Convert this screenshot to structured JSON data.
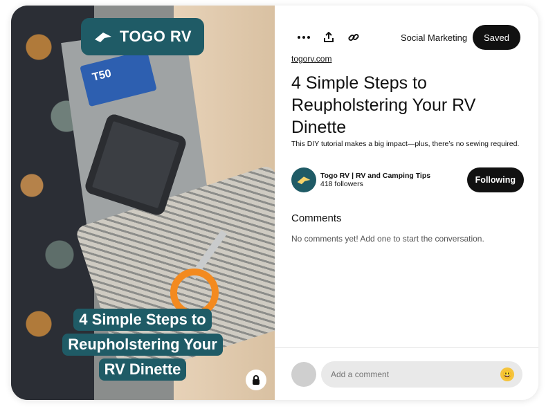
{
  "pin": {
    "logo_text": "TOGO RV",
    "overlay_lines": [
      "4 Simple Steps to",
      "Reupholstering Your",
      "RV Dinette"
    ],
    "stapler_box_text": "T50"
  },
  "toolbar": {
    "more_icon": "more-icon",
    "share_icon": "share-icon",
    "link_icon": "link-icon",
    "board_label": "Social Marketing",
    "saved_label": "Saved"
  },
  "details": {
    "domain": "togorv.com",
    "title": "4 Simple Steps to Reupholstering Your RV Dinette",
    "description": "This DIY tutorial makes a big impact—plus, there’s no sewing required."
  },
  "creator": {
    "name": "Togo RV | RV and Camping Tips",
    "followers": "418 followers",
    "follow_label": "Following"
  },
  "comments": {
    "heading": "Comments",
    "empty_text": "No comments yet! Add one to start the conversation.",
    "placeholder": "Add a comment",
    "emoji": "😃"
  },
  "colors": {
    "brand_teal": "#1f5b66",
    "button_dark": "#111111",
    "scissor_orange": "#f38a1f"
  }
}
